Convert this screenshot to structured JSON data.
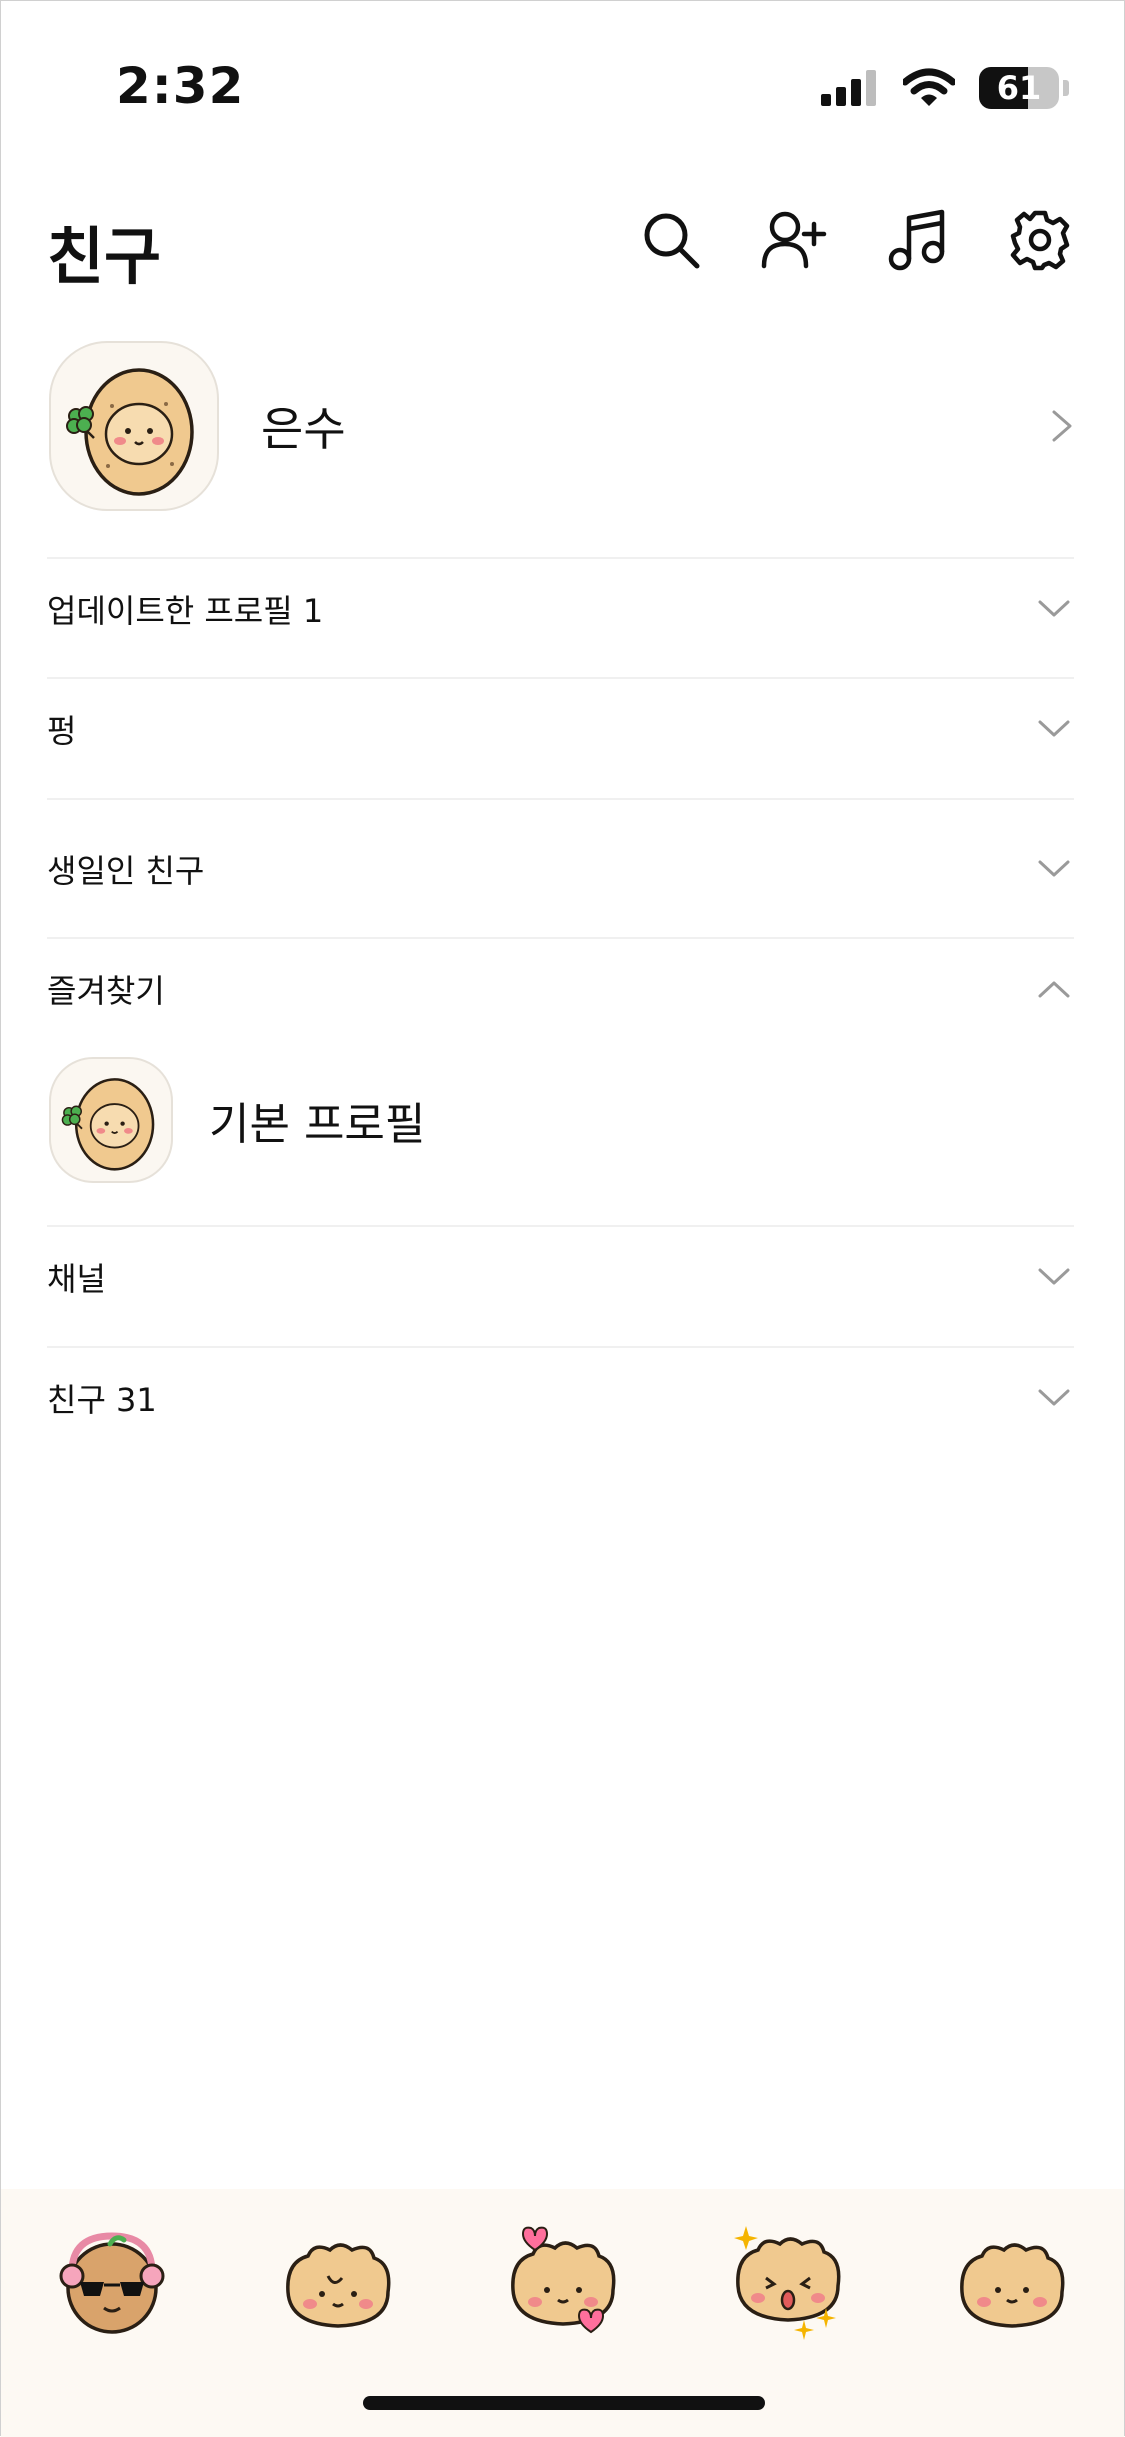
{
  "status_bar": {
    "time": "2:32",
    "battery": "61"
  },
  "header": {
    "title": "친구",
    "icons": [
      "search-icon",
      "add-friend-icon",
      "music-icon",
      "settings-icon"
    ]
  },
  "my_profile": {
    "name": "은수"
  },
  "sections": [
    {
      "id": "updated",
      "label": "업데이트한 프로필 1",
      "expanded": false
    },
    {
      "id": "pyeong",
      "label": "펑",
      "expanded": false
    },
    {
      "id": "birthday",
      "label": "생일인 친구",
      "expanded": false
    },
    {
      "id": "favorites",
      "label": "즐겨찾기",
      "expanded": true
    },
    {
      "id": "channel",
      "label": "채널",
      "expanded": false
    },
    {
      "id": "friends",
      "label": "친구 31",
      "expanded": false
    }
  ],
  "favorites": [
    {
      "name": "기본 프로필"
    }
  ],
  "colors": {
    "character": "#f0c98f",
    "character_outline": "#2a1f14",
    "blush": "#f08a8a",
    "clover": "#4caf50",
    "nav_bg": "#fdf9f3",
    "heart": "#ff6f9c",
    "sparkle": "#f5b400"
  },
  "bottom_nav": {
    "tabs": [
      "tab-friends",
      "tab-chats",
      "tab-open-chat",
      "tab-shopping",
      "tab-more"
    ]
  }
}
